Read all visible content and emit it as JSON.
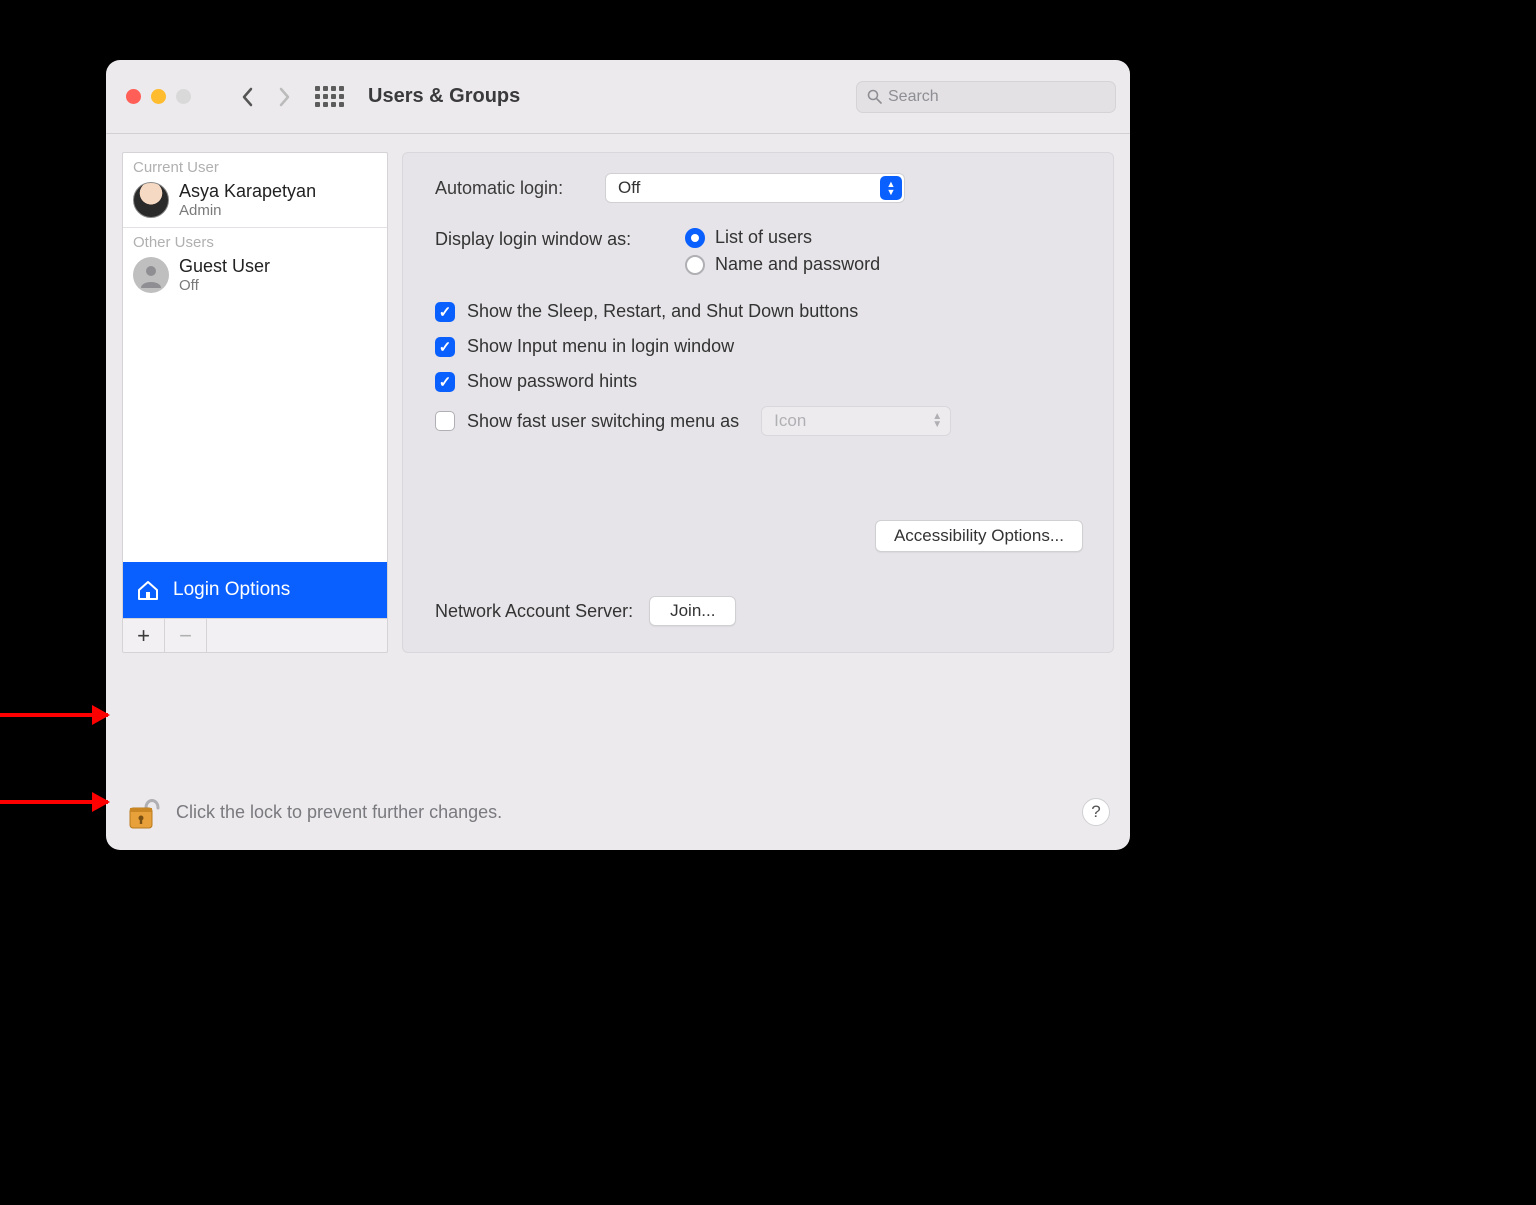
{
  "window": {
    "title": "Users & Groups",
    "search_placeholder": "Search"
  },
  "sidebar": {
    "current_user_heading": "Current User",
    "other_users_heading": "Other Users",
    "current_user": {
      "name": "Asya Karapetyan",
      "role": "Admin"
    },
    "other_users": [
      {
        "name": "Guest User",
        "role": "Off"
      }
    ],
    "login_options_label": "Login Options",
    "add_label": "+",
    "remove_label": "−"
  },
  "settings": {
    "auto_login_label": "Automatic login:",
    "auto_login_value": "Off",
    "display_login_label": "Display login window as:",
    "display_login_options": {
      "list": "List of users",
      "namepw": "Name and password"
    },
    "display_login_selected": "list",
    "checkboxes": {
      "sleep_restart": {
        "label": "Show the Sleep, Restart, and Shut Down buttons",
        "checked": true
      },
      "input_menu": {
        "label": "Show Input menu in login window",
        "checked": true
      },
      "pw_hints": {
        "label": "Show password hints",
        "checked": true
      },
      "fast_switch": {
        "label": "Show fast user switching menu as",
        "checked": false
      }
    },
    "fast_switch_menu_value": "Icon",
    "accessibility_button": "Accessibility Options...",
    "network_server_label": "Network Account Server:",
    "join_button": "Join..."
  },
  "footer": {
    "lock_text": "Click the lock to prevent further changes."
  }
}
